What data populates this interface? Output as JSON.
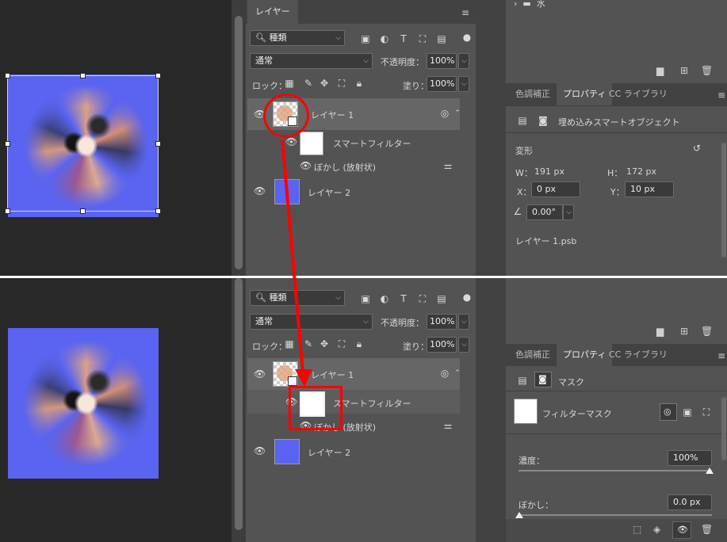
{
  "layers_panel": {
    "tab_label": "レイヤー",
    "kind_filter": "種類",
    "blend_mode": "通常",
    "opacity_label": "不透明度：",
    "opacity_value": "100%",
    "lock_label": "ロック：",
    "fill_label": "塗り：",
    "fill_value": "100%",
    "layer1_name": "レイヤー 1",
    "smart_filter_label": "スマートフィルター",
    "filter_name": "ぼかし (放射状)",
    "layer2_name": "レイヤー 2"
  },
  "properties_panel": {
    "tabs": [
      "色調補正",
      "プロパティ",
      "CC ライブラリ"
    ],
    "top_folder_label": "水",
    "embedded_label": "埋め込みスマートオブジェクト",
    "transform_label": "変形",
    "w_label": "W：",
    "w_value": "191 px",
    "h_label": "H：",
    "h_value": "172 px",
    "x_label": "X：",
    "x_value": "0 px",
    "y_label": "Y：",
    "y_value": "10 px",
    "angle_value": "0.00°",
    "file_name": "レイヤー 1.psb",
    "mask_label": "マスク",
    "filter_mask_label": "フィルターマスク",
    "density_label": "濃度：",
    "density_value": "100%",
    "feather_label": "ぼかし：",
    "feather_value": "0.0 px"
  },
  "colors": {
    "artwork_blue": "#5a64f0",
    "annotation_red": "#ff0000",
    "panel_bg": "#535353"
  }
}
